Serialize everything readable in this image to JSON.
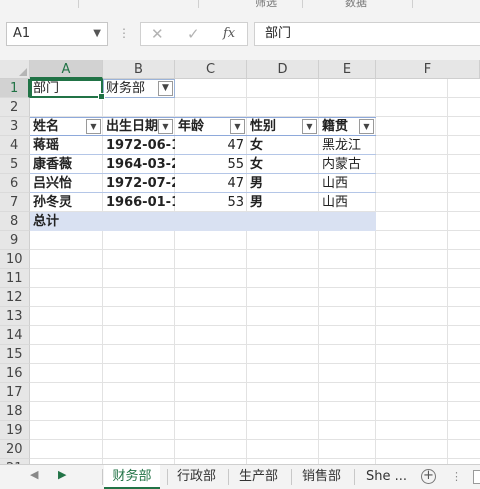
{
  "ribbon": {
    "group_labels": [
      "筛选",
      "数据"
    ]
  },
  "formula_bar": {
    "name_box": "A1",
    "cancel_glyph": "✕",
    "enter_glyph": "✓",
    "fx_label": "fx",
    "content": "部门"
  },
  "columns": [
    "A",
    "B",
    "C",
    "D",
    "E",
    "F"
  ],
  "rows": [
    "1",
    "2",
    "3",
    "4",
    "5",
    "6",
    "7",
    "8",
    "9",
    "10",
    "11",
    "12",
    "13",
    "14",
    "15",
    "16",
    "17",
    "18",
    "19",
    "20",
    "21"
  ],
  "pivot": {
    "filter_label": "部门",
    "filter_value": "财务部",
    "headers": [
      "姓名",
      "出生日期",
      "年龄",
      "性别",
      "籍贯"
    ],
    "records": [
      {
        "name": "蒋瑶",
        "birth": "1972-06-1",
        "age": "47",
        "gender": "女",
        "origin": "黑龙江"
      },
      {
        "name": "康香薇",
        "birth": "1964-03-2",
        "age": "55",
        "gender": "女",
        "origin": "内蒙古"
      },
      {
        "name": "吕兴怡",
        "birth": "1972-07-2",
        "age": "47",
        "gender": "男",
        "origin": "山西"
      },
      {
        "name": "孙冬灵",
        "birth": "1966-01-1",
        "age": "53",
        "gender": "男",
        "origin": "山西"
      }
    ],
    "total_label": "总计"
  },
  "sheet_tabs": [
    "财务部",
    "行政部",
    "生产部",
    "销售部",
    "She ..."
  ],
  "active_tab": "财务部",
  "add_sheet_glyph": "+",
  "accent_color": "#217346",
  "table_band_color": "#d9e1f2"
}
